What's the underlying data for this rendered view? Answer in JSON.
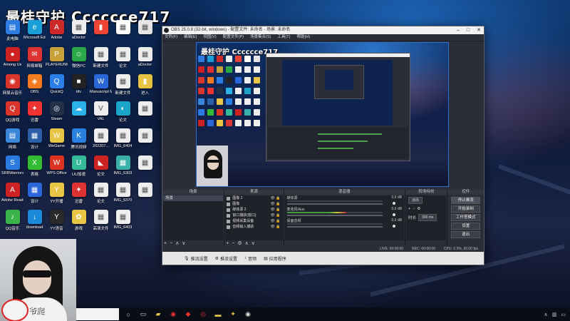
{
  "stream_title": "最桂守护 Cccccce717",
  "webcam_label": "爷爬",
  "desktop_icons": [
    {
      "label": "此电脑",
      "color": "#2d7be0",
      "sym": "▤"
    },
    {
      "label": "Microsoft Edge",
      "color": "#1a9fd9",
      "sym": "e"
    },
    {
      "label": "Adobe",
      "color": "#cf2a2a",
      "sym": "A"
    },
    {
      "label": "aDoctor",
      "color": "#eee",
      "sym": "▦"
    },
    {
      "label": "",
      "color": "#e43",
      "sym": "▮"
    },
    {
      "label": "",
      "color": "#fff",
      "sym": "▦"
    },
    {
      "label": "",
      "color": "#e6e6e6",
      "sym": "▦"
    },
    {
      "label": "Among Us",
      "color": "#c22",
      "sym": "●"
    },
    {
      "label": "网易邮箱",
      "color": "#d33",
      "sym": "✉"
    },
    {
      "label": "PLAYERUNKNOWN'S BATTLEGR...",
      "color": "#c9a13a",
      "sym": "P"
    },
    {
      "label": "微信PC",
      "color": "#2ba84a",
      "sym": "☺"
    },
    {
      "label": "新建文件",
      "color": "#eee",
      "sym": "▦"
    },
    {
      "label": "论文",
      "color": "#eee",
      "sym": "▦"
    },
    {
      "label": "aDoctor",
      "color": "#eee",
      "sym": "▦"
    },
    {
      "label": "网易云音乐",
      "color": "#d9352d",
      "sym": "◉"
    },
    {
      "label": "OBS",
      "color": "#f47b20",
      "sym": "◈"
    },
    {
      "label": "QuickQ",
      "color": "#2a7ee8",
      "sym": "Q"
    },
    {
      "label": "ldv",
      "color": "#222",
      "sym": "■"
    },
    {
      "label": "Manuscript Mobile P...",
      "color": "#2a66d9",
      "sym": "W"
    },
    {
      "label": "新建文件",
      "color": "#eee",
      "sym": "▦"
    },
    {
      "label": "进入",
      "color": "#e9c545",
      "sym": "▮"
    },
    {
      "label": "QQ游戏",
      "color": "#d9352d",
      "sym": "Q"
    },
    {
      "label": "迅雷",
      "color": "#e33",
      "sym": "✦"
    },
    {
      "label": "Steam",
      "color": "#22304a",
      "sym": "◎"
    },
    {
      "label": "",
      "color": "#2bb3e9",
      "sym": "☁"
    },
    {
      "label": "VAL",
      "color": "#eee",
      "sym": "V"
    },
    {
      "label": "论文",
      "color": "#1aa5c9",
      "sym": "◐"
    },
    {
      "label": "",
      "color": "#eee",
      "sym": "▦"
    },
    {
      "label": "网络",
      "color": "#3a86d9",
      "sym": "▤"
    },
    {
      "label": "设计",
      "color": "#2b5fa8",
      "sym": "▦"
    },
    {
      "label": "WeGame",
      "color": "#e9c545",
      "sym": "W"
    },
    {
      "label": "腾讯视频",
      "color": "#2a80e0",
      "sym": "K"
    },
    {
      "label": "202207...",
      "color": "#eee",
      "sym": "▦"
    },
    {
      "label": "IMG_6404",
      "color": "#eee",
      "sym": "▦"
    },
    {
      "label": "",
      "color": "#eee",
      "sym": "▦"
    },
    {
      "label": "SRBWarriors",
      "color": "#2a7ae0",
      "sym": "S"
    },
    {
      "label": "表格",
      "color": "#3b3",
      "sym": "X"
    },
    {
      "label": "WPS Office",
      "color": "#d32",
      "sym": "W"
    },
    {
      "label": "UU加速",
      "color": "#3b9",
      "sym": "U"
    },
    {
      "label": "论文",
      "color": "#c22",
      "sym": "◣"
    },
    {
      "label": "IMG_5303",
      "color": "#3ab0a8",
      "sym": "▦"
    },
    {
      "label": "",
      "color": "#eee",
      "sym": "▦"
    },
    {
      "label": "Adobe Reader XI",
      "color": "#c22",
      "sym": "A"
    },
    {
      "label": "设计",
      "color": "#2a66d9",
      "sym": "▦"
    },
    {
      "label": "YY开播",
      "color": "#e9c545",
      "sym": "Y"
    },
    {
      "label": "迅雷",
      "color": "#d33",
      "sym": "✦"
    },
    {
      "label": "论文",
      "color": "#eee",
      "sym": "▦"
    },
    {
      "label": "IMG_5370",
      "color": "#eee",
      "sym": "▦"
    },
    {
      "label": "",
      "color": "#eee",
      "sym": "▦"
    },
    {
      "label": "QQ音乐",
      "color": "#3ab34a",
      "sym": "♪"
    },
    {
      "label": "download",
      "color": "#1a8ad9",
      "sym": "↓"
    },
    {
      "label": "YY语音",
      "color": "#2a2a2a",
      "sym": "Y"
    },
    {
      "label": "游戏",
      "color": "#e9c545",
      "sym": "✿"
    },
    {
      "label": "高清文件",
      "color": "#eee",
      "sym": "▦"
    },
    {
      "label": "IMG_6403",
      "color": "#eee",
      "sym": "▦"
    }
  ],
  "obs": {
    "window_title": "OBS 25.0.8 (32-bit, windows) - 配置文件: 未命名 - 场景: 未命名",
    "menu": [
      "文件(F)",
      "编辑(E)",
      "视图(V)",
      "配置文件(P)",
      "场景集合(S)",
      "工具(T)",
      "帮助(H)"
    ],
    "preview_title": "最桂守护 Cccccce717",
    "docks": {
      "scenes_title": "场景",
      "sources_title": "来源",
      "mixer_title": "混音器",
      "transitions_title": "转场特效",
      "controls_title": "控件"
    },
    "scenes": [
      "场景"
    ],
    "sources": [
      "图像 2",
      "图像",
      "媒体源 2",
      "窗口捕获(窗口)",
      "视频采集设备",
      "音频输入捕获"
    ],
    "mixer": [
      {
        "name": "媒体源",
        "db": "0.0 dB",
        "level": 0.0
      },
      {
        "name": "麦克风/Aux",
        "db": "0.0 dB",
        "level": 0.62
      },
      {
        "name": "桌面音频",
        "db": "0.0 dB",
        "level": 0.0
      }
    ],
    "transition": {
      "type": "淡出",
      "duration_label": "时长",
      "duration": "300 ms"
    },
    "controls": [
      "停止推流",
      "开始录制",
      "工作室模式",
      "设置",
      "退出"
    ],
    "status": {
      "live": "LIVE: 00:00:00",
      "rec": "REC: 00:00:00",
      "cpu": "CPU: 2.3%, 30.00 fps"
    },
    "bottom_bar": [
      "推流设置",
      "推流设置",
      "音频",
      "应用程序"
    ]
  },
  "taskbar": {
    "time": ""
  }
}
